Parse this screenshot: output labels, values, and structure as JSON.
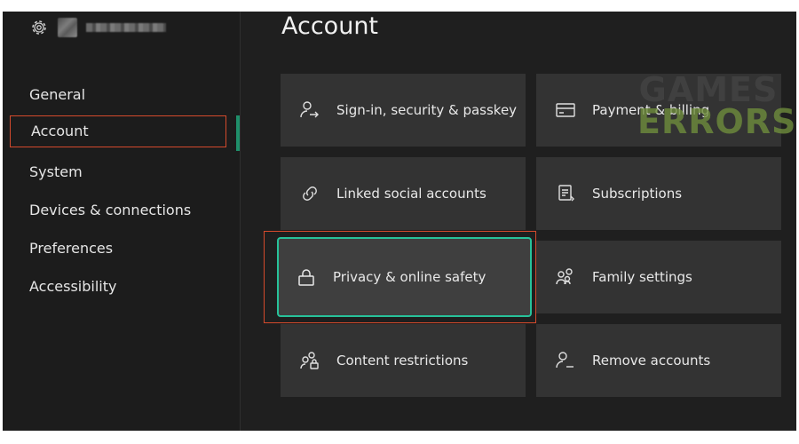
{
  "header": {
    "gear_icon": "gear-icon",
    "avatar": "avatar-blurred",
    "gamertag": "blurred-gamertag"
  },
  "sidebar": {
    "items": [
      {
        "label": "General",
        "selected": false
      },
      {
        "label": "Account",
        "selected": true
      },
      {
        "label": "System",
        "selected": false
      },
      {
        "label": "Devices & connections",
        "selected": false
      },
      {
        "label": "Preferences",
        "selected": false
      },
      {
        "label": "Accessibility",
        "selected": false
      }
    ]
  },
  "main": {
    "title": "Account",
    "tiles": [
      {
        "label": "Sign-in, security & passkey",
        "icon": "person-arrow-icon"
      },
      {
        "label": "Payment & billing",
        "icon": "card-icon"
      },
      {
        "label": "Linked social accounts",
        "icon": "link-icon"
      },
      {
        "label": "Subscriptions",
        "icon": "document-icon"
      },
      {
        "label": "Privacy & online safety",
        "icon": "lock-icon",
        "focused": true
      },
      {
        "label": "Family settings",
        "icon": "family-icon"
      },
      {
        "label": "Content restrictions",
        "icon": "restricted-person-icon"
      },
      {
        "label": "Remove accounts",
        "icon": "remove-person-icon"
      }
    ]
  },
  "watermark": {
    "line1": "GAMES",
    "line2": "ERRORS"
  },
  "colors": {
    "highlight_outline": "#d44a2c",
    "focus_border": "#27c29a",
    "nav_indicator": "#1f8f6a",
    "tile_background": "#333333"
  }
}
